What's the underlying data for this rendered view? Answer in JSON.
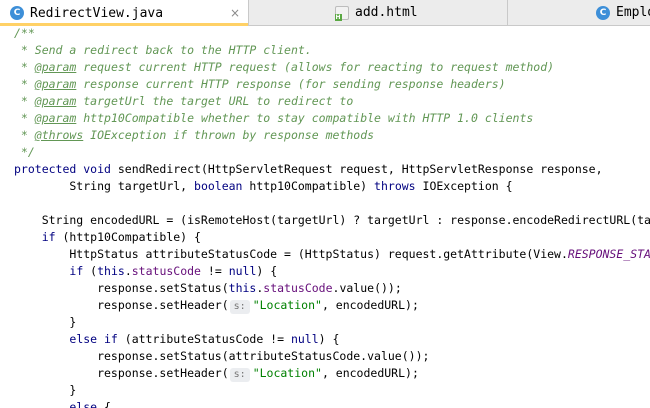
{
  "tabs": [
    {
      "label": "RedirectView.java",
      "icon": "java-class-icon",
      "close": "×"
    },
    {
      "label": "add.html",
      "icon": "html-file-icon"
    },
    {
      "label": "Employ",
      "icon": "java-class-icon"
    }
  ],
  "code": {
    "l1": "/**",
    "l2": " * Send a redirect back to the HTTP client.",
    "l3a": " * ",
    "l3tag": "@param",
    "l3b": " request current HTTP request (allows for reacting to request method)",
    "l4a": " * ",
    "l4tag": "@param",
    "l4b": " response current HTTP response (for sending response headers)",
    "l5a": " * ",
    "l5tag": "@param",
    "l5b": " targetUrl the target URL to redirect to",
    "l6a": " * ",
    "l6tag": "@param",
    "l6b": " http10Compatible whether to stay compatible with HTTP 1.0 clients",
    "l7a": " * ",
    "l7tag": "@throws",
    "l7b": " IOException if thrown by response methods",
    "l8": " */",
    "l9kw": "protected void",
    "l9b": " sendRedirect(HttpServletRequest request, HttpServletResponse response,",
    "l10a": "        String targetUrl, ",
    "l10kw": "boolean",
    "l10b": " http10Compatible) ",
    "l10kw2": "throws",
    "l10c": " IOException {",
    "l12": "    String encodedURL = (isRemoteHost(targetUrl) ? targetUrl : response.encodeRedirectURL(targetUrl));",
    "l13a": "    ",
    "l13kw": "if",
    "l13b": " (http10Compatible) {",
    "l14a": "        HttpStatus attributeStatusCode = (HttpStatus) request.getAttribute(View.",
    "l14const": "RESPONSE_STATUS_ATTRIBUTE",
    "l14b": ");",
    "l15a": "        ",
    "l15kw": "if",
    "l15b": " (",
    "l15kw2": "this",
    "l15c": ".",
    "l15fld": "statusCode",
    "l15d": " != ",
    "l15kw3": "null",
    "l15e": ") {",
    "l16a": "            response.setStatus(",
    "l16kw": "this",
    "l16b": ".",
    "l16fld": "statusCode",
    "l16c": ".value());",
    "l17a": "            response.setHeader(",
    "l17hint": "s:",
    "l17str": "\"Location\"",
    "l17b": ", encodedURL);",
    "l18": "        }",
    "l19a": "        ",
    "l19kw": "else if",
    "l19b": " (attributeStatusCode != ",
    "l19kw2": "null",
    "l19c": ") {",
    "l20": "            response.setStatus(attributeStatusCode.value());",
    "l21a": "            response.setHeader(",
    "l21hint": "s:",
    "l21str": "\"Location\"",
    "l21b": ", encodedURL);",
    "l22": "        }",
    "l23a": "        ",
    "l23kw": "else",
    "l23b": " {"
  }
}
